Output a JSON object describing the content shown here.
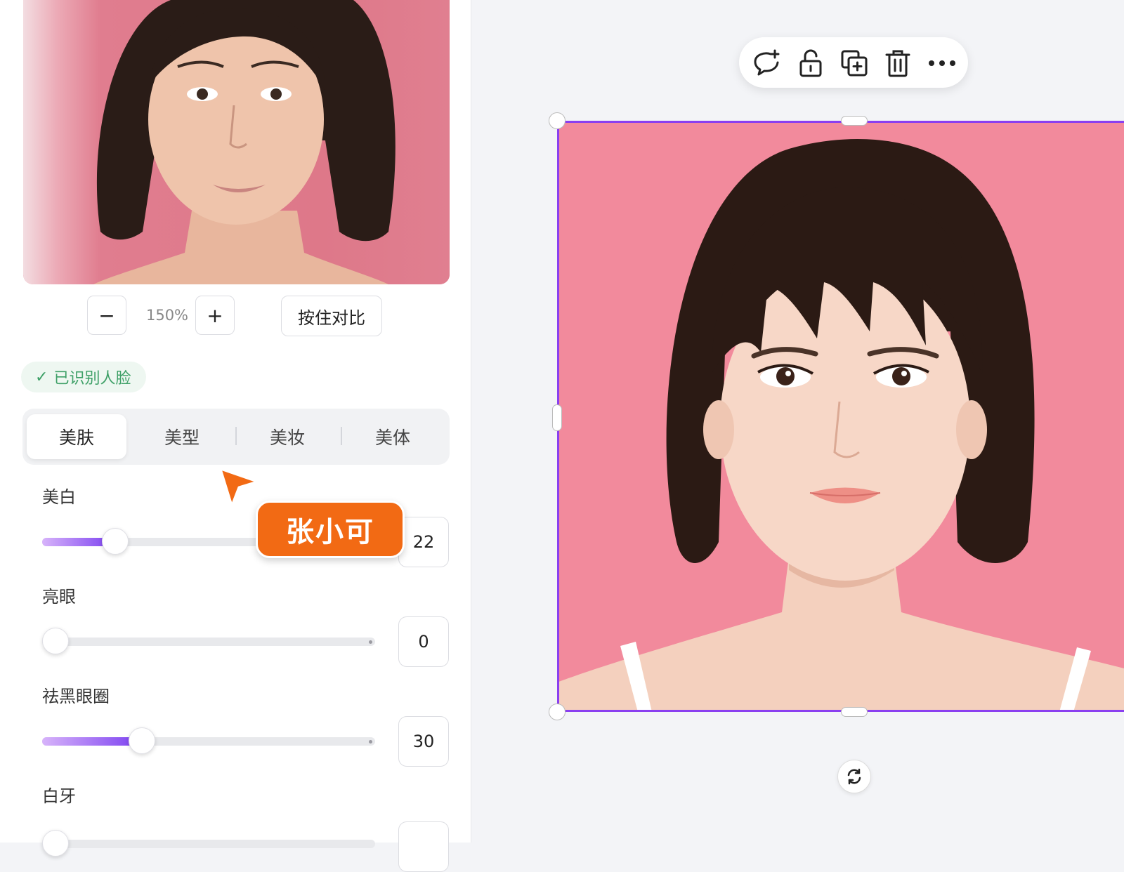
{
  "preview": {
    "zoom_out_label": "−",
    "zoom_value": "150%",
    "zoom_in_label": "+",
    "compare_label": "按住对比"
  },
  "face_badge": {
    "check": "✓",
    "text": "已识别人脸"
  },
  "tabs": [
    {
      "label": "美肤",
      "active": true
    },
    {
      "label": "美型",
      "active": false
    },
    {
      "label": "美妆",
      "active": false
    },
    {
      "label": "美体",
      "active": false
    }
  ],
  "sliders": [
    {
      "label": "美白",
      "value": "22",
      "level": 0.22
    },
    {
      "label": "亮眼",
      "value": "0",
      "level": 0
    },
    {
      "label": "祛黑眼圈",
      "value": "30",
      "level": 0.3
    },
    {
      "label": "白牙",
      "value": "",
      "level": 0
    }
  ],
  "collaborator": {
    "name": "张小可",
    "color": "#f26a14"
  },
  "toolbar": {
    "icons": [
      "comment-add-icon",
      "lock-icon",
      "duplicate-icon",
      "trash-icon",
      "more-icon"
    ]
  },
  "colors": {
    "accent": "#8a3ff0",
    "success": "#3ea067",
    "photo_background": "#f28a9c"
  }
}
